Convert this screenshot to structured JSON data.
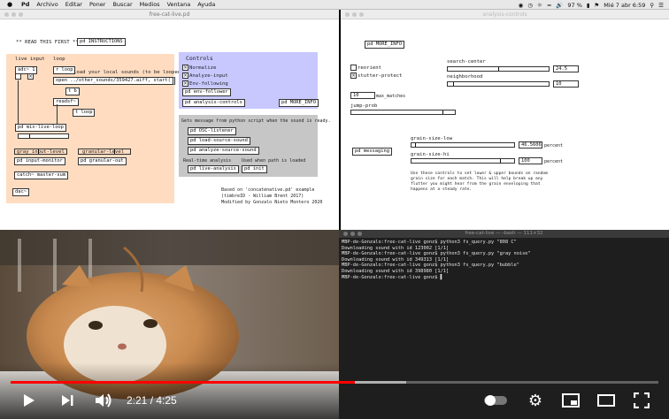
{
  "menubar": {
    "items": [
      "Pd",
      "Archivo",
      "Editar",
      "Poner",
      "Buscar",
      "Medios",
      "Ventana",
      "Ayuda"
    ],
    "battery": "97 %",
    "datetime": "Mié 7 abr  6:59"
  },
  "pd_main": {
    "title": "free-cat-live.pd",
    "read_first": "** READ THIS FIRST ** ->",
    "instructions_btn": "pd INSTRUCTIONS",
    "live_input_label": "live input",
    "loop_label": "loop",
    "adc_label": "adc~ 1",
    "loop_obj": "r loop",
    "load_note": "load your local sounds (to be looped)",
    "open_msg": "open ../other_sounds/359427.aiff, start(",
    "bang1": "t b",
    "bang2": "t loop",
    "readsf": "readsf~",
    "mix_label": "pd mix-live-loop",
    "live_loop_label": "live-loop",
    "gray_level": "gray input-level",
    "granular_level": "granular-level",
    "input_monitor": "pd input-monitor",
    "granular_out": "pd granular-out",
    "catch_label": "catch~ master-sum",
    "dac_label": "dac~",
    "controls_title": "Controls",
    "normalize_label": "Normalize",
    "analyze_label": "Analyze-input",
    "env_label": "Env-following",
    "env_follower": "pd env-follower",
    "analysis_controls": "pd analysis-controls",
    "more_info_btn": "pd MORE_INFO",
    "msg_note": "Gets message from python script when the sound is ready.",
    "osc_listener": "pd OSC-listener",
    "load_source": "pd load-source-sound",
    "analyze_source": "pd analyze-source-sound",
    "realtime_label": "Real-time analysis",
    "used_label": "Used when path is loaded",
    "live_analysis": "pd live-analysis",
    "init_label": "pd init",
    "credit_1": "Based on 'concatenative.pd' example",
    "credit_2": "(timbreID - William Brent 2017)",
    "credit_3": "Modified by Gonzalo Nieto Montero 2020"
  },
  "pd_analysis": {
    "title": "analysis-controls",
    "more_info_btn": "pd MORE_INFO",
    "reorient_label": "reorient",
    "stutter_label": "stutter-protect",
    "search_center_label": "search-center",
    "search_center_val": "24.5",
    "neighborhood_label": "neighborhood",
    "neighborhood_val": "10",
    "max_matches_val": "10",
    "max_matches_label": "max_matches",
    "jump_prob_label": "jump-prob",
    "messaging_label": "pd messaging",
    "grain_low_label": "grain-size-low",
    "grain_low_val": "46.5606",
    "grain_low_unit": "percent",
    "grain_hi_label": "grain-size-hi",
    "grain_hi_val": "100",
    "grain_hi_unit": "percent",
    "note_1": "Use these controls to set lower & upper bounds on random",
    "note_2": "grain size for each match. This will help break up any",
    "note_3": "flutter you might hear from the grain enveloping that",
    "note_4": "happens at a steady rate."
  },
  "terminal": {
    "title": "free-cat-live — -bash — 111×32",
    "lines": [
      "MBP-de-Gonzalo:free-cat-live gonz$ python3 fs_query.py \"808 C\"",
      "Downloading sound with id 123002 [1/1]",
      "MBP-de-Gonzalo:free-cat-live gonz$ python3 fs_query.py \"gray noise\"",
      "Downloading sound with id 349313 [1/1]",
      "MBP-de-Gonzalo:free-cat-live gonz$ python3 fs_query.py \"bubble\"",
      "Downloading sound with id 398980 [1/1]",
      "MBP-de-Gonzalo:free-cat-live gonz$ ▌"
    ]
  },
  "player": {
    "time": "2:21 / 4:25",
    "progress": 0.532,
    "buffer": 0.61,
    "accent": "#ff0000"
  }
}
